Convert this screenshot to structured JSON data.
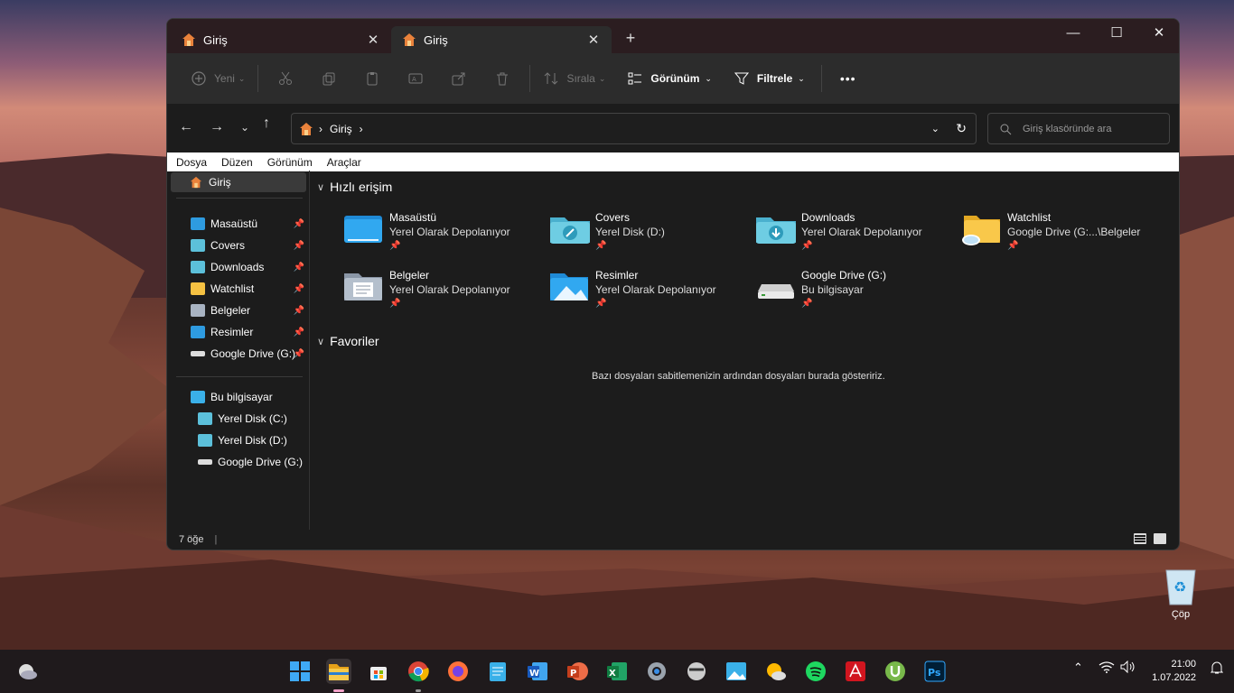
{
  "window": {
    "tabs": [
      {
        "label": "Giriş"
      },
      {
        "label": "Giriş"
      }
    ],
    "new_tab": "+",
    "controls": {
      "minimize": "—",
      "maximize": "☐",
      "close": "✕"
    }
  },
  "toolbar": {
    "new_label": "Yeni",
    "sort_label": "Sırala",
    "view_label": "Görünüm",
    "filter_label": "Filtrele",
    "more_label": "•••"
  },
  "address": {
    "path": "Giriş",
    "search_placeholder": "Giriş klasöründe ara"
  },
  "menu": [
    "Dosya",
    "Düzen",
    "Görünüm",
    "Araçlar"
  ],
  "nav": {
    "home": "Giriş",
    "pinned": [
      {
        "label": "Masaüstü",
        "icon": "desktop-icon",
        "color": "#2e9be0"
      },
      {
        "label": "Covers",
        "icon": "folder-icon",
        "color": "#5cc0da"
      },
      {
        "label": "Downloads",
        "icon": "download-folder-icon",
        "color": "#5cc0da"
      },
      {
        "label": "Watchlist",
        "icon": "folder-icon",
        "color": "#f5c142"
      },
      {
        "label": "Belgeler",
        "icon": "documents-icon",
        "color": "#a8b3c2"
      },
      {
        "label": "Resimler",
        "icon": "pictures-icon",
        "color": "#2e9be0"
      },
      {
        "label": "Google Drive (G:)",
        "icon": "drive-icon",
        "color": "#dddddd"
      }
    ],
    "this_pc": "Bu bilgisayar",
    "drives": [
      "Yerel Disk (C:)",
      "Yerel Disk (D:)",
      "Google Drive (G:)"
    ]
  },
  "quick_access": {
    "title": "Hızlı erişim",
    "items": [
      {
        "name": "Masaüstü",
        "sub": "Yerel Olarak Depolanıyor"
      },
      {
        "name": "Covers",
        "sub": "Yerel Disk (D:)"
      },
      {
        "name": "Downloads",
        "sub": "Yerel Olarak Depolanıyor"
      },
      {
        "name": "Watchlist",
        "sub": "Google Drive (G:...\\Belgeler"
      },
      {
        "name": "Belgeler",
        "sub": "Yerel Olarak Depolanıyor"
      },
      {
        "name": "Resimler",
        "sub": "Yerel Olarak Depolanıyor"
      },
      {
        "name": "Google Drive (G:)",
        "sub": "Bu bilgisayar"
      }
    ]
  },
  "favorites": {
    "title": "Favoriler",
    "empty_text": "Bazı dosyaları sabitlemenizin ardından dosyaları burada gösteririz."
  },
  "status": {
    "count": "7 öğe"
  },
  "desktop": {
    "recycle_bin": "Çöp"
  },
  "taskbar": {
    "apps": [
      "start",
      "file-explorer",
      "store",
      "chrome",
      "firefox",
      "notepad",
      "word",
      "powerpoint",
      "excel",
      "settings",
      "app",
      "photos",
      "weather",
      "spotify",
      "acrobat",
      "utorrent",
      "photoshop"
    ],
    "time": "21:00",
    "date": "1.07.2022"
  }
}
